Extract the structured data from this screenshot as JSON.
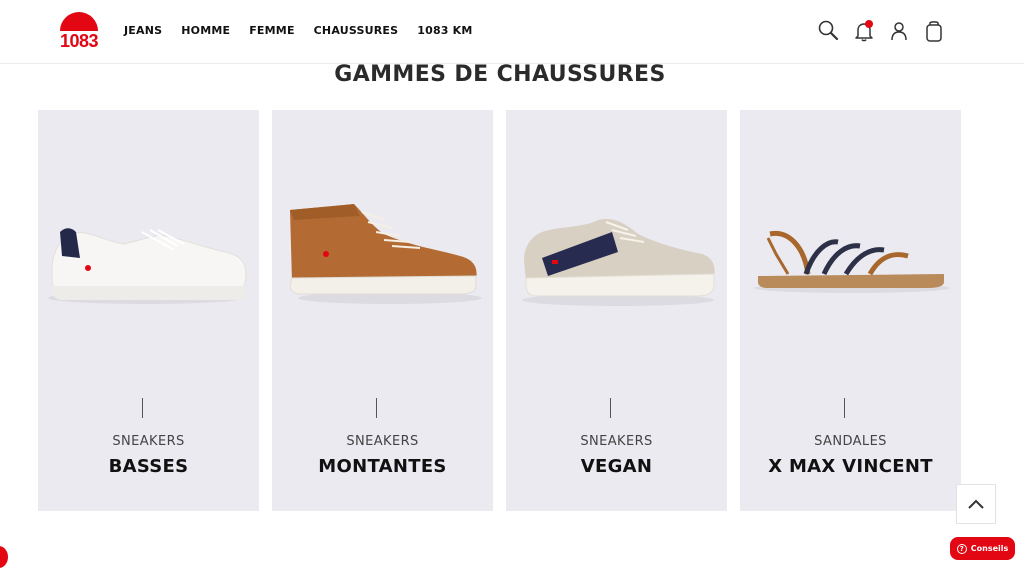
{
  "brand": {
    "logo_text": "1083",
    "accent_color": "#e30613"
  },
  "nav": {
    "items": [
      {
        "label": "JEANS"
      },
      {
        "label": "HOMME"
      },
      {
        "label": "FEMME"
      },
      {
        "label": "CHAUSSURES"
      },
      {
        "label": "1083 KM"
      }
    ]
  },
  "header_icons": [
    "search-icon",
    "bell-icon",
    "user-icon",
    "cart-icon"
  ],
  "section": {
    "title": "GAMMES DE CHAUSSURES"
  },
  "cards": [
    {
      "category": "SNEAKERS",
      "name": "BASSES",
      "image": "white-low-sneaker"
    },
    {
      "category": "SNEAKERS",
      "name": "MONTANTES",
      "image": "brown-high-sneaker"
    },
    {
      "category": "SNEAKERS",
      "name": "VEGAN",
      "image": "beige-navy-sneaker"
    },
    {
      "category": "SANDALES",
      "name": "X MAX VINCENT",
      "image": "strappy-sandal"
    }
  ],
  "scroll_top": {
    "icon": "chevron-up-icon"
  },
  "help": {
    "label": "Conseils",
    "icon": "question-icon"
  }
}
